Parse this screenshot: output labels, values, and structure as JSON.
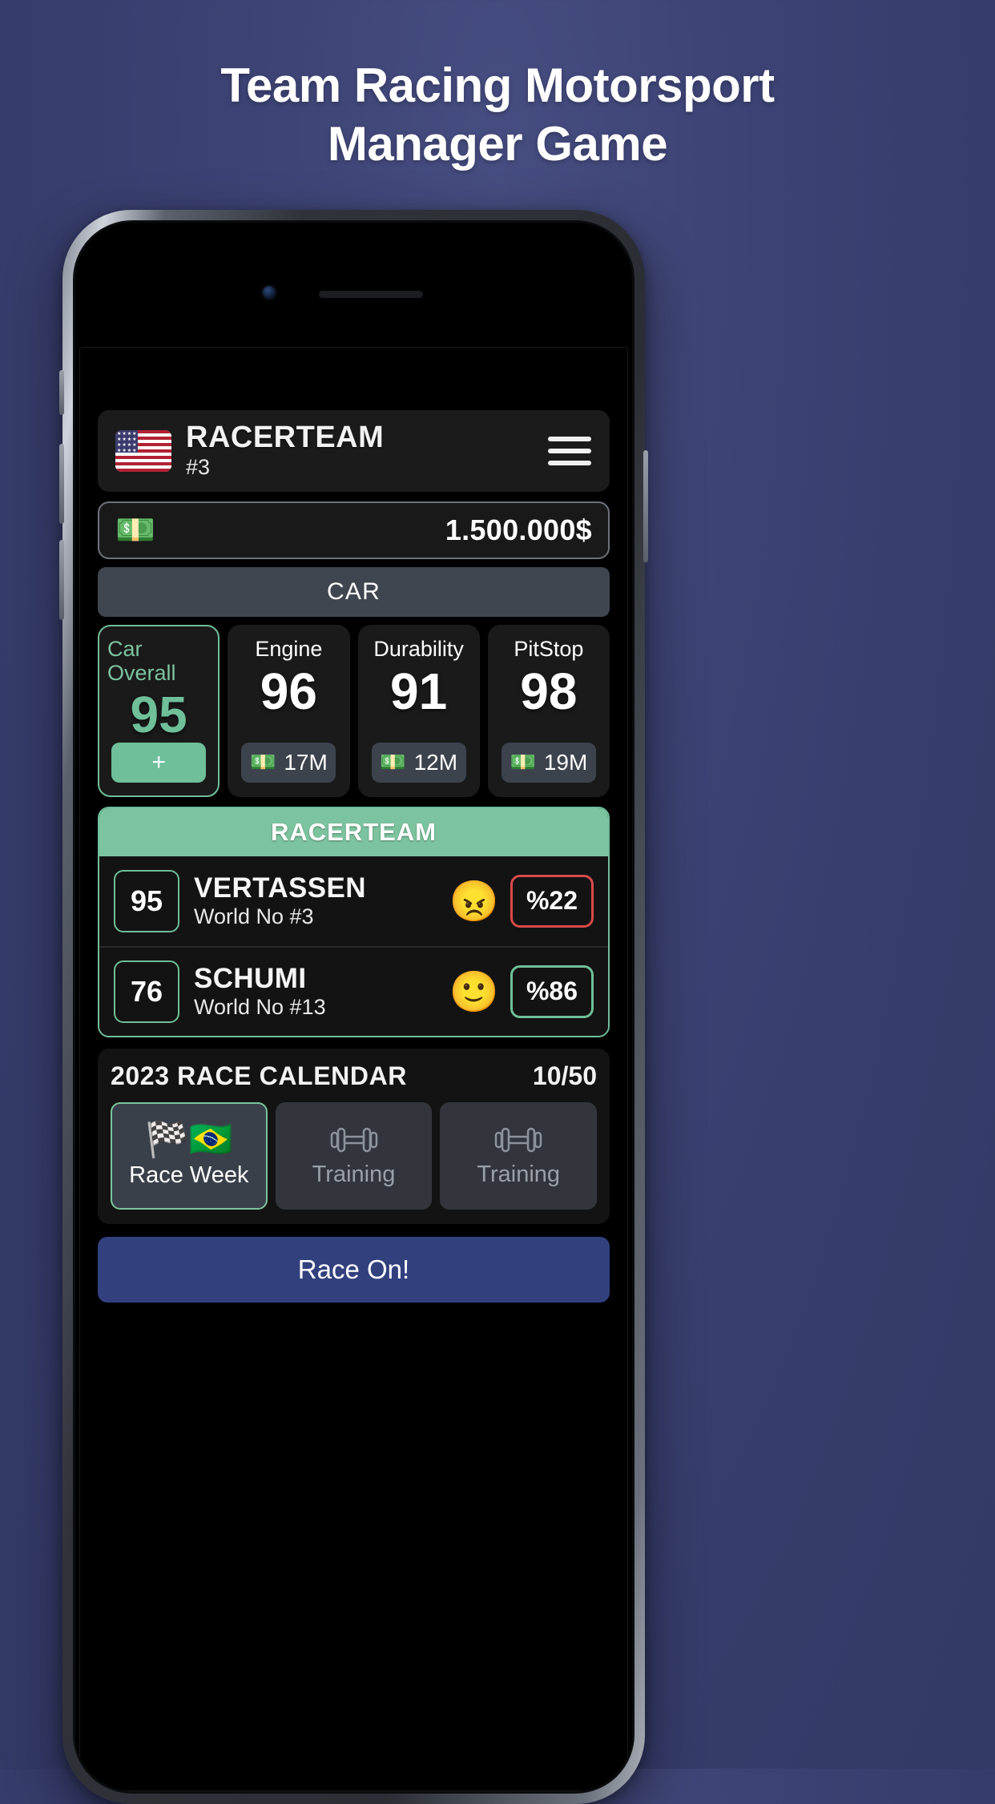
{
  "promo": {
    "headline_line1": "Team Racing Motorsport",
    "headline_line2": "Manager Game"
  },
  "app": {
    "header": {
      "flag_icon": "us-flag-icon",
      "team_name": "RACERTEAM",
      "team_rank": "#3",
      "menu_icon": "hamburger-menu-icon"
    },
    "money": {
      "icon": "money-banknote-icon",
      "amount": "1.500.000$"
    },
    "car_section": {
      "title": "CAR",
      "stats": [
        {
          "label": "Car Overall",
          "value": "95",
          "action": "+",
          "primary": true
        },
        {
          "label": "Engine",
          "value": "96",
          "cost": "17M",
          "primary": false
        },
        {
          "label": "Durability",
          "value": "91",
          "cost": "12M",
          "primary": false
        },
        {
          "label": "PitStop",
          "value": "98",
          "cost": "19M",
          "primary": false
        }
      ]
    },
    "drivers": {
      "title": "RACERTEAM",
      "list": [
        {
          "overall": "95",
          "name": "VERTASSEN",
          "world_rank": "World No #3",
          "mood": "angry-face-icon",
          "mood_emoji": "😠",
          "percent": "%22",
          "percent_state": "danger"
        },
        {
          "overall": "76",
          "name": "SCHUMI",
          "world_rank": "World No #13",
          "mood": "neutral-face-icon",
          "mood_emoji": "🙂",
          "percent": "%86",
          "percent_state": "ok"
        }
      ]
    },
    "calendar": {
      "title": "2023 RACE CALENDAR",
      "counter": "10/50",
      "items": [
        {
          "label": "Race Week",
          "icons": "🏁🇧🇷",
          "state": "active",
          "icon_name": "checkered-flag-icon"
        },
        {
          "label": "Training",
          "icons": "",
          "state": "inactive",
          "icon_name": "dumbbell-icon"
        },
        {
          "label": "Training",
          "icons": "",
          "state": "inactive",
          "icon_name": "dumbbell-icon"
        }
      ]
    },
    "primary_action": {
      "label": "Race On!"
    }
  },
  "colors": {
    "accent_green": "#6fbf9a",
    "danger_red": "#d94a4a",
    "race_button_blue": "#32407e",
    "background_blue": "#3c4273"
  }
}
